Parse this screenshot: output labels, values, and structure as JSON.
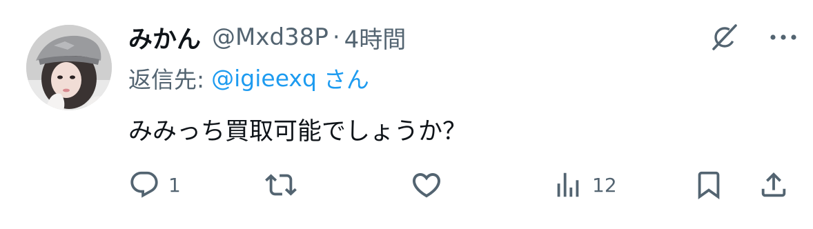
{
  "user": {
    "display_name": "みかん",
    "handle": "@Mxd38P",
    "separator": "·",
    "time": "4時間"
  },
  "reply": {
    "prefix": "返信先:",
    "handle": "@igieexq",
    "suffix": "さん"
  },
  "tweet": {
    "text": "みみっち買取可能でしょうか？"
  },
  "actions": {
    "reply_count": "1",
    "repost_count": "",
    "like_count": "",
    "views_count": "12"
  },
  "icons": {
    "reply": "reply-icon",
    "repost": "repost-icon",
    "like": "like-icon",
    "views": "views-icon",
    "bookmark": "bookmark-icon",
    "share": "share-icon",
    "grok": "grok-icon",
    "more": "more-icon"
  },
  "colors": {
    "text_primary": "#0f1419",
    "text_secondary": "#536471",
    "link": "#1d9bf0",
    "background": "#ffffff"
  }
}
